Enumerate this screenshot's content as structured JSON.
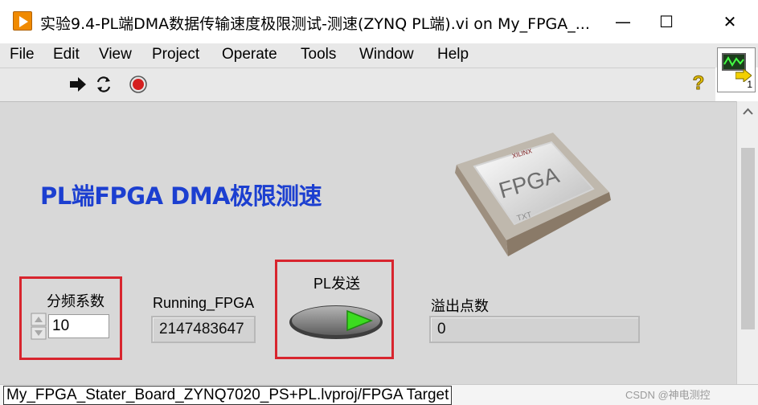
{
  "window": {
    "title": "实验9.4-PL端DMA数据传输速度极限测试-测速(ZYNQ PL端).vi on My_FPGA_...",
    "minimize_glyph": "—",
    "maximize_glyph": "☐",
    "close_glyph": "✕"
  },
  "menu": {
    "items": [
      "File",
      "Edit",
      "View",
      "Project",
      "Operate",
      "Tools",
      "Window",
      "Help"
    ]
  },
  "toolbar": {
    "icons": [
      "run-arrow-icon",
      "run-continuously-icon",
      "abort-icon"
    ],
    "help_glyph": "?",
    "vi_icon_number": "1"
  },
  "panel": {
    "heading": "PL端FPGA DMA极限测速",
    "chip_image": {
      "brand": "XILINX",
      "label": "FPGA",
      "sub": "TXT"
    },
    "divider": {
      "label": "分频系数",
      "value": "10"
    },
    "running": {
      "label": "Running_FPGA",
      "value": "2147483647"
    },
    "pl_send": {
      "label": "PL发送"
    },
    "overflow": {
      "label": "溢出点数",
      "value": "0"
    }
  },
  "status": {
    "path": "My_FPGA_Stater_Board_ZYNQ7020_PS+PL.lvproj/FPGA Target",
    "watermark": "CSDN @神电测控"
  },
  "colors": {
    "heading": "#1c3fd0",
    "highlight_box": "#d8252e",
    "led_on": "#3cdc20",
    "panel_bg": "#d8d8d8"
  }
}
